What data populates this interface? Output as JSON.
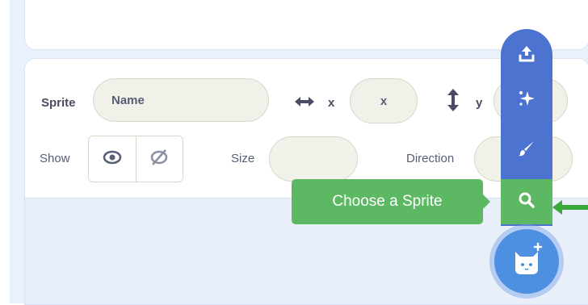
{
  "sprite_info": {
    "sprite_label": "Sprite",
    "name_placeholder": "Name",
    "x_label": "x",
    "x_placeholder": "x",
    "y_label": "y",
    "show_label": "Show",
    "size_label": "Size",
    "direction_label": "Direction"
  },
  "sidebar": {
    "buttons": [
      {
        "icon": "upload-icon"
      },
      {
        "icon": "surprise-sparkle-icon"
      },
      {
        "icon": "paint-brush-icon"
      },
      {
        "icon": "search-icon"
      },
      {
        "icon": "cat-add-icon"
      }
    ],
    "tooltip": "Choose a Sprite"
  },
  "colors": {
    "sidebar_blue": "#4c73cf",
    "highlight_green": "#5cb863",
    "cat_button_blue": "#4d8fe0",
    "panel_bg": "#e9f1fb"
  }
}
